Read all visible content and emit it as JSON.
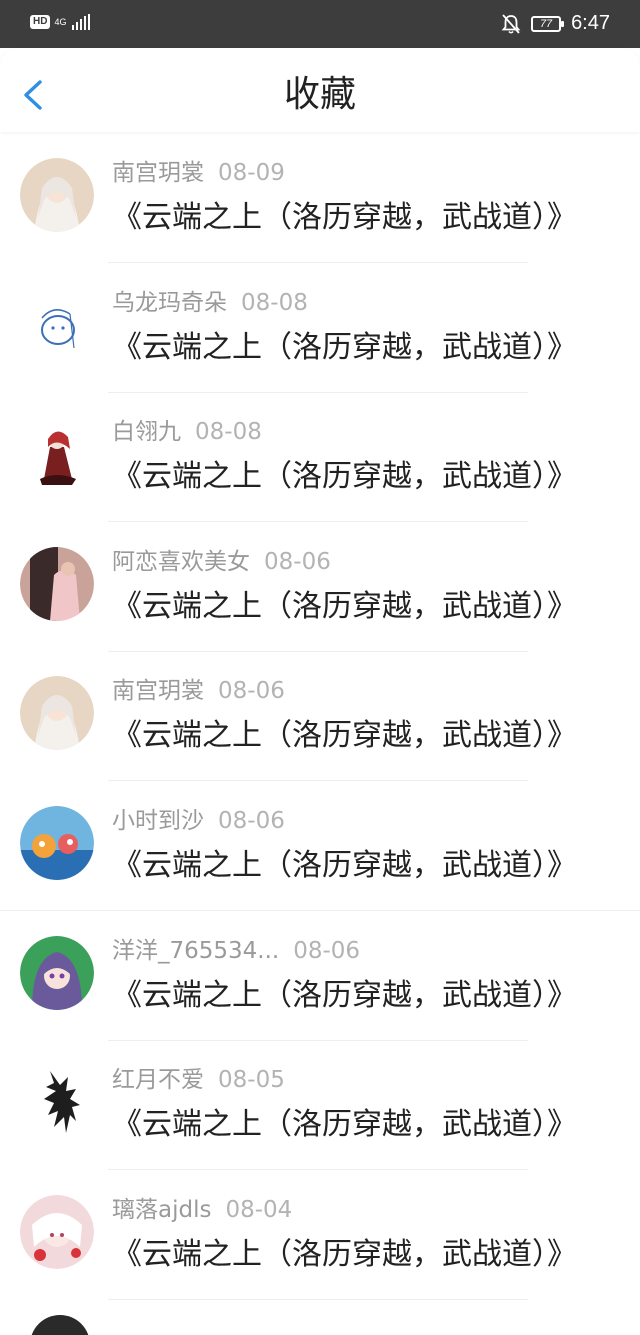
{
  "status_bar": {
    "hd_label": "HD",
    "network_label": "4G",
    "battery_level": "77",
    "time": "6:47"
  },
  "header": {
    "title": "收藏",
    "back_icon": "chevron-left-icon"
  },
  "items": [
    {
      "user": "南宫玥裳",
      "date": "08-09",
      "title": "《云端之上（洛历穿越，武战道）》",
      "avatar_color": "#e8d6c4"
    },
    {
      "user": "乌龙玛奇朵",
      "date": "08-08",
      "title": "《云端之上（洛历穿越，武战道）》",
      "avatar_color": "#ffffff"
    },
    {
      "user": "白翎九",
      "date": "08-08",
      "title": "《云端之上（洛历穿越，武战道）》",
      "avatar_color": "#ffffff"
    },
    {
      "user": "阿恋喜欢美女",
      "date": "08-06",
      "title": "《云端之上（洛历穿越，武战道）》",
      "avatar_color": "#c9a39a"
    },
    {
      "user": "南宫玥裳",
      "date": "08-06",
      "title": "《云端之上（洛历穿越，武战道）》",
      "avatar_color": "#e8d6c4"
    },
    {
      "user": "小时到沙",
      "date": "08-06",
      "title": "《云端之上（洛历穿越，武战道）》",
      "avatar_color": "#6fb5e0"
    },
    {
      "user": "洋洋_765534...",
      "date": "08-06",
      "title": "《云端之上（洛历穿越，武战道）》",
      "avatar_color": "#6a5a9c"
    },
    {
      "user": "红月不爱",
      "date": "08-05",
      "title": "《云端之上（洛历穿越，武战道）》",
      "avatar_color": "#ffffff"
    },
    {
      "user": "璃落ajdls",
      "date": "08-04",
      "title": "《云端之上（洛历穿越，武战道）》",
      "avatar_color": "#f2d9dc"
    }
  ]
}
